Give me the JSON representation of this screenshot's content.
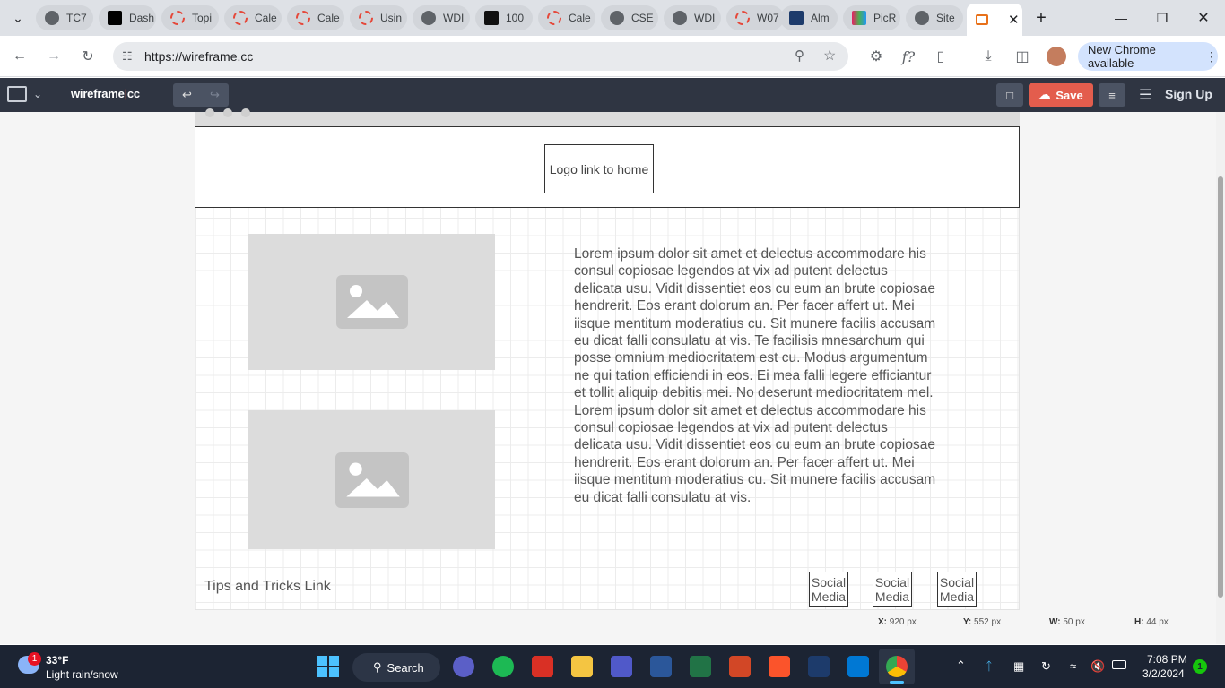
{
  "browser": {
    "tabs": [
      {
        "label": "TC7",
        "icon": "chrome-icon"
      },
      {
        "label": "Dash",
        "icon": "byu-icon"
      },
      {
        "label": "Topi",
        "icon": "canvas-icon"
      },
      {
        "label": "Cale",
        "icon": "canvas-icon"
      },
      {
        "label": "Cale",
        "icon": "canvas-icon"
      },
      {
        "label": "Usin",
        "icon": "canvas-icon"
      },
      {
        "label": "WDI",
        "icon": "chrome-icon"
      },
      {
        "label": "100",
        "icon": "site-icon"
      },
      {
        "label": "Cale",
        "icon": "canvas-icon"
      },
      {
        "label": "CSE",
        "icon": "chrome-icon"
      },
      {
        "label": "WDI",
        "icon": "chrome-icon"
      },
      {
        "label": "W07",
        "icon": "canvas-icon"
      },
      {
        "label": "Alm",
        "icon": "site-icon"
      },
      {
        "label": "PicR",
        "icon": "picr-icon"
      },
      {
        "label": "Site",
        "icon": "chrome-icon"
      }
    ],
    "url": "https://wireframe.cc",
    "update_label": "New Chrome available"
  },
  "wireframe_app": {
    "logo": "wireframe",
    "logo_suffix": "cc",
    "save_label": "Save",
    "signup_label": "Sign Up"
  },
  "mockup": {
    "logo_box": "Logo link to home",
    "body_text": "Lorem ipsum dolor sit amet et delectus accommodare his consul copiosae legendos at vix ad putent delectus delicata usu. Vidit dissentiet eos cu eum an brute copiosae hendrerit. Eos erant dolorum an. Per facer affert ut. Mei iisque mentitum moderatius cu. Sit munere facilis accusam eu dicat falli consulatu at vis. Te facilisis mnesarchum qui posse omnium mediocritatem est cu. Modus argumentum ne qui tation efficiendi in eos. Ei mea falli legere efficiantur et tollit aliquip debitis mei. No deserunt mediocritatem mel. Lorem ipsum dolor sit amet et delectus accommodare his consul copiosae legendos at vix ad putent delectus delicata usu. Vidit dissentiet eos cu eum an brute copiosae hendrerit. Eos erant dolorum an. Per facer affert ut. Mei iisque mentitum moderatius cu. Sit munere facilis accusam eu dicat falli consulatu at vis.",
    "footer_link": "Tips and Tricks Link",
    "social": [
      "Social Media",
      "Social Media",
      "Social Media"
    ]
  },
  "selection_readout": {
    "x_label": "X:",
    "x_value": "920 px",
    "y_label": "Y:",
    "y_value": "552 px",
    "w_label": "W:",
    "w_value": "50 px",
    "h_label": "H:",
    "h_value": "44 px"
  },
  "taskbar": {
    "weather_badge": "1",
    "weather_temp": "33°F",
    "weather_desc": "Light rain/snow",
    "search_label": "Search",
    "time": "7:08 PM",
    "date": "3/2/2024",
    "notification_count": "1"
  },
  "colors": {
    "accent_save": "#e35d4d",
    "wf_bar": "#2f3542",
    "chrome_update": "#d3e3fd"
  }
}
